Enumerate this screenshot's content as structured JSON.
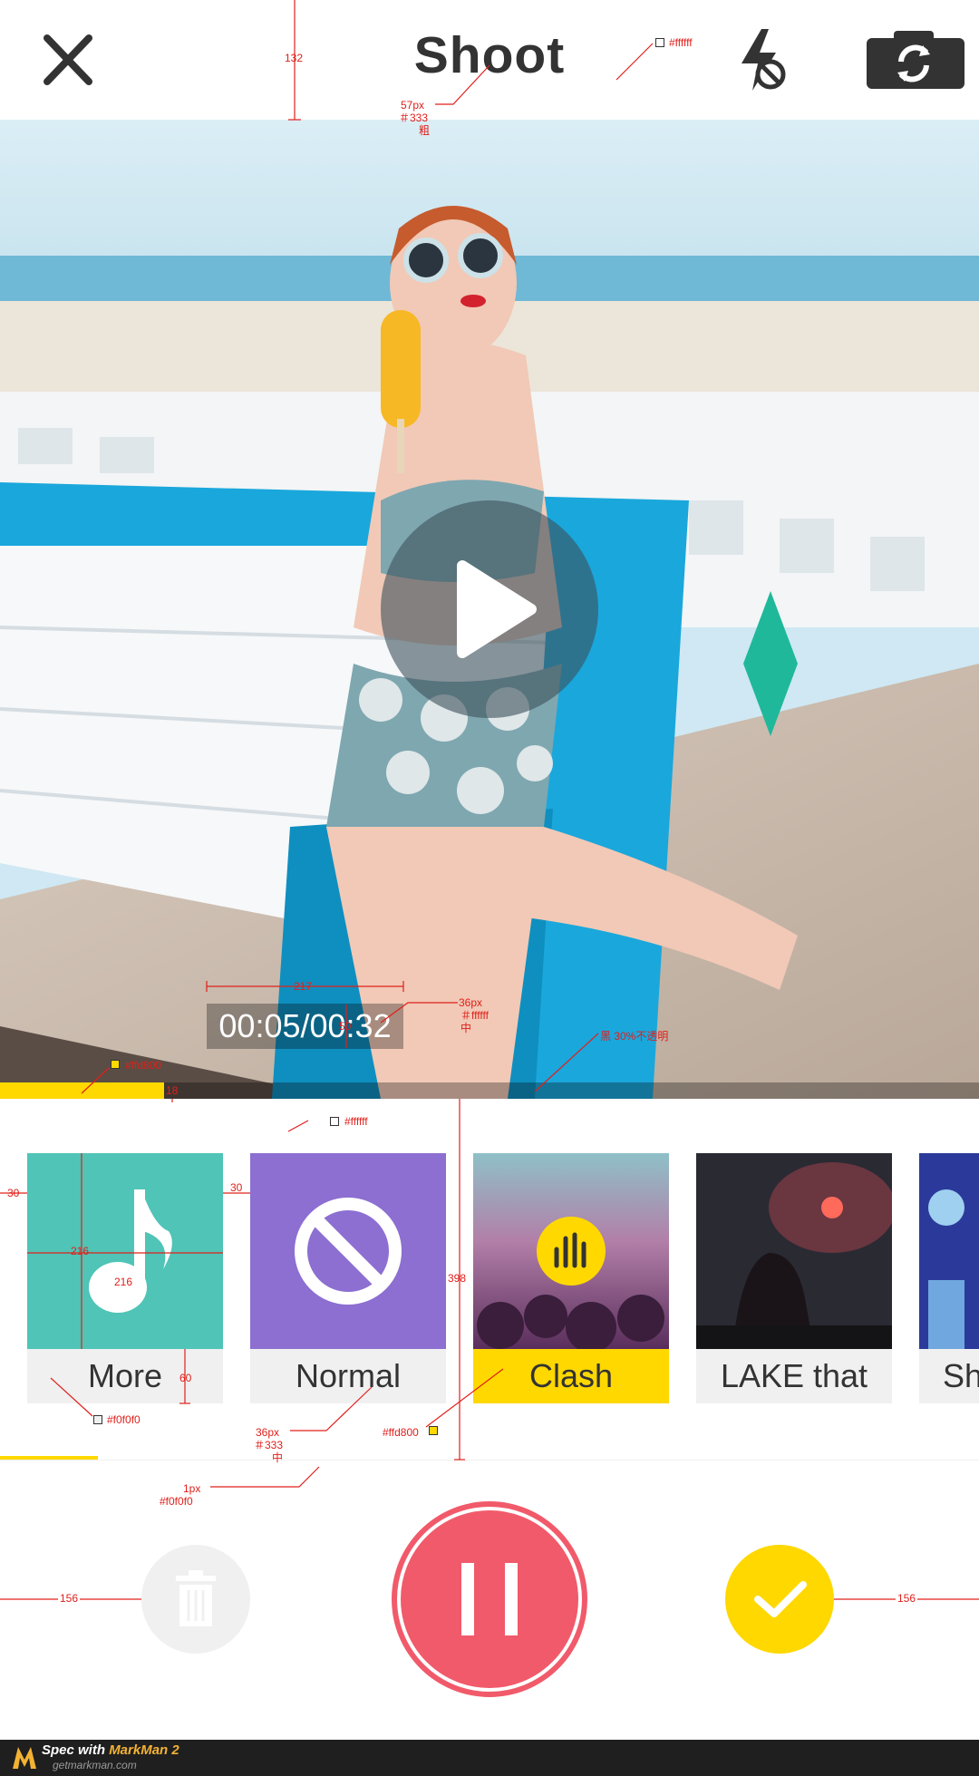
{
  "header": {
    "title": "Shoot",
    "close_icon": "close-icon",
    "flash_icon": "flash-off-icon",
    "camera_icon": "camera-switch-icon"
  },
  "preview": {
    "play_icon": "play-icon",
    "timer": "00:05/00:32",
    "progress": 0.168
  },
  "music": {
    "tracks": [
      {
        "label": "More",
        "icon": "music-note-icon",
        "color": "#4fc4b7",
        "selected": false
      },
      {
        "label": "Normal",
        "icon": "no-music-icon",
        "color": "#8c6fd1",
        "selected": false
      },
      {
        "label": "Clash",
        "icon": "equalizer-icon",
        "selected": true
      },
      {
        "label": "LAKE that",
        "selected": false
      },
      {
        "label": "Sh",
        "selected": false
      }
    ],
    "scroll_position": 0.1
  },
  "controls": {
    "delete_icon": "trash-icon",
    "record_icon": "pause-icon",
    "confirm_icon": "check-icon"
  },
  "colors": {
    "accent": "#ffd800",
    "record": "#f15a6a",
    "text": "#333333",
    "label_bg": "#f0f0f0",
    "overlay": "rgba(0,0,0,0.3)"
  },
  "footer": {
    "spec_prefix": "Spec with ",
    "brand": "MarkMan 2",
    "site": "getmarkman.com"
  },
  "annotations": {
    "header_height": "132",
    "title_size": "57px",
    "title_color": "＃333",
    "title_weight": "粗",
    "white_color": "#ffffff",
    "timer_width": "217",
    "timer_height": "50",
    "timer_font": "36px",
    "timer_color": "＃ffffff",
    "timer_weight": "中",
    "overlay_desc": "黑   30%不透明",
    "accent_color": "#ffd800",
    "progress_height": "18",
    "list_white": "#ffffff",
    "margin_left": "30",
    "margin_gap": "30",
    "thumb_height": "216",
    "thumb_width": "216",
    "label_height": "60",
    "list_height": "398",
    "label_bg": "#f0f0f0",
    "label_font": "36px",
    "label_color": "＃333",
    "label_weight": "中",
    "selected_color": "#ffd800",
    "divider_size": "1px",
    "divider_color": "#f0f0f0",
    "side_margin_left": "156",
    "side_margin_right": "156"
  }
}
